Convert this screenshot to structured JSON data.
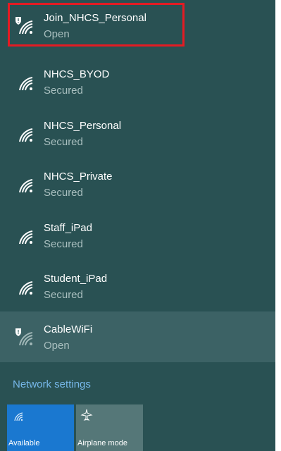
{
  "networks": [
    {
      "name": "Join_NHCS_Personal",
      "status": "Open",
      "open": true
    },
    {
      "name": "NHCS_BYOD",
      "status": "Secured",
      "open": false
    },
    {
      "name": "NHCS_Personal",
      "status": "Secured",
      "open": false
    },
    {
      "name": "NHCS_Private",
      "status": "Secured",
      "open": false
    },
    {
      "name": "Staff_iPad",
      "status": "Secured",
      "open": false
    },
    {
      "name": "Student_iPad",
      "status": "Secured",
      "open": false
    },
    {
      "name": "CableWiFi",
      "status": "Open",
      "open": true
    }
  ],
  "network_settings_label": "Network settings",
  "tiles": {
    "wifi": {
      "label": "Available",
      "icon": "wifi-icon",
      "color": "#1a78d0"
    },
    "airplane": {
      "label": "Airplane mode",
      "icon": "airplane-icon",
      "color": "#557778"
    }
  },
  "colors": {
    "background": "#295153",
    "hover_row": "#3c6265",
    "highlight": "#e41b23",
    "link": "#76b7e8"
  }
}
